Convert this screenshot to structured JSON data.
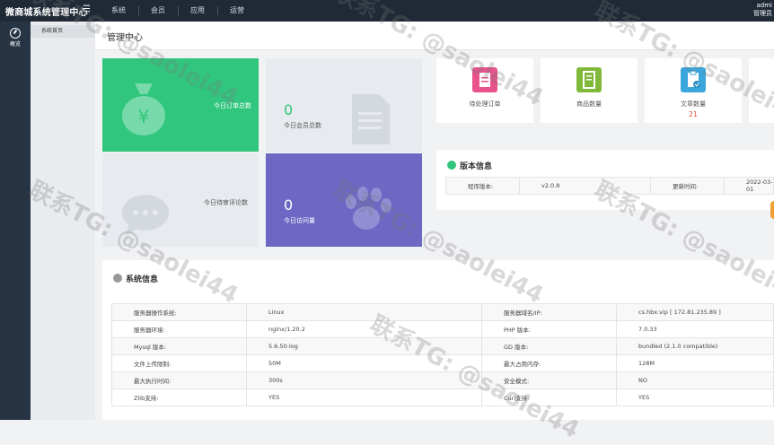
{
  "header": {
    "brand": "微商城系统管理中心",
    "menu_icon": "☰",
    "nav": [
      "系统",
      "会员",
      "应用",
      "运营"
    ],
    "user_name": "admi",
    "user_role": "管理员"
  },
  "sidebar": {
    "item_label": "概览"
  },
  "subnav": {
    "item_label": "系统首页"
  },
  "page": {
    "title": "管理中心"
  },
  "tiles": [
    {
      "label": "今日订单总数",
      "value": ""
    },
    {
      "label": "今日会员总数",
      "value": "0"
    },
    {
      "label": "今日待审评论数",
      "value": ""
    },
    {
      "label": "今日访问量",
      "value": "0"
    }
  ],
  "stats": [
    {
      "label": "待处理订单",
      "value": "",
      "color": "#e8538c"
    },
    {
      "label": "商品数量",
      "value": "",
      "color": "#80b93a"
    },
    {
      "label": "文章数量",
      "value": "21",
      "color": "#3aa6dc"
    }
  ],
  "version": {
    "title": "版本信息",
    "program_label": "程序版本:",
    "program_value": "v2.0.8",
    "update_label": "更新时间:",
    "update_value": "2022-03-01"
  },
  "system": {
    "title": "系统信息",
    "rows": [
      [
        "服务器操作系统:",
        "Linux",
        "服务器域名/IP:",
        "cs.hbx.vip [ 172.81.235.89 ]"
      ],
      [
        "服务器环境:",
        "nginx/1.20.2",
        "PHP 版本:",
        "7.0.33"
      ],
      [
        "Mysql 版本:",
        "5.6.50-log",
        "GD 版本:",
        "bundled (2.1.0 compatible)"
      ],
      [
        "文件上传限制:",
        "50M",
        "最大占用内存:",
        "128M"
      ],
      [
        "最大执行时间:",
        "300s",
        "安全模式:",
        "NO"
      ],
      [
        "Zlib支持:",
        "YES",
        "Curl支持:",
        "YES"
      ]
    ]
  },
  "watermark": "联系TG: @saolei44",
  "colors": {
    "header_bg": "#1f2a36",
    "green": "#31c67d",
    "purple": "#6e68c4"
  }
}
